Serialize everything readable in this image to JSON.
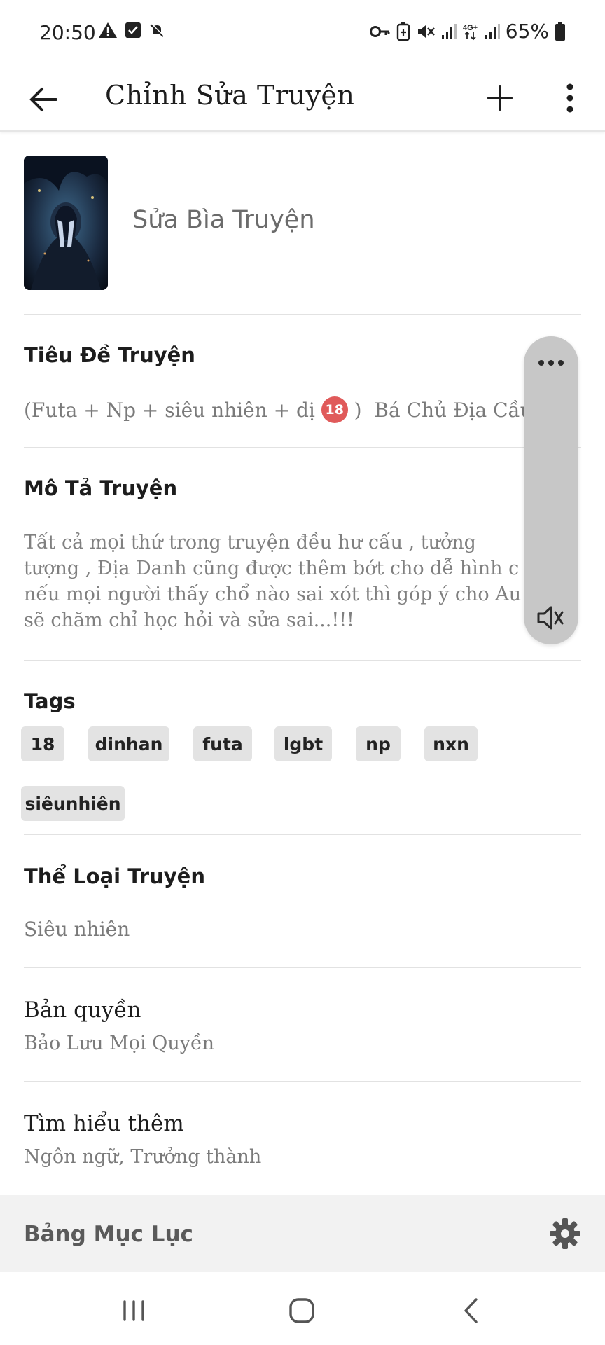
{
  "status_bar": {
    "time": "20:50",
    "battery_percent": "65%",
    "icons": [
      "warning-icon",
      "checkbox-icon",
      "mute-bell-icon",
      "key-icon",
      "battery-saver-icon",
      "vibrate-mute-icon",
      "signal-icon",
      "4g-icon",
      "signal-icon-2",
      "battery-icon"
    ]
  },
  "app_bar": {
    "title": "Chỉnh Sửa Truyện",
    "icons": [
      "back-arrow-icon",
      "plus-icon",
      "more-vert-icon"
    ]
  },
  "cover": {
    "label": "Sửa Bìa Truyện"
  },
  "story_title": {
    "label": "Tiêu Đề Truyện",
    "value_before_badge": "(Futa + Np + siêu nhiên + dị ",
    "badge": "18",
    "value_after_badge": " )  Bá Chủ Địa Cầu ."
  },
  "description": {
    "label": "Mô Tả Truyện",
    "lines": [
      "Tất cả mọi thứ trong truyện đều hư cấu , tưởng",
      "tượng  , Địa Danh cũng được thêm bớt cho dễ hình c",
      "nếu mọi người thấy chổ nào sai xót thì góp ý cho Au",
      "sẽ chăm chỉ học hỏi và sửa sai...!!!"
    ]
  },
  "tags": {
    "label": "Tags",
    "items": [
      "18",
      "dinhan",
      "futa",
      "lgbt",
      "np",
      "nxn",
      "siêunhiên"
    ]
  },
  "genre": {
    "label": "Thể Loại Truyện",
    "value": "Siêu nhiên"
  },
  "copyright": {
    "label": "Bản quyền",
    "value": "Bảo Lưu Mọi Quyền"
  },
  "learn_more": {
    "label": "Tìm hiểu thêm",
    "value": "Ngôn ngữ, Trưởng thành"
  },
  "toc": {
    "label": "Bảng Mục Lục"
  },
  "colors": {
    "tag_bg": "#e3e3e3",
    "divider": "#e2e2e2",
    "float_panel": "#c7c7c7",
    "badge_red": "#e05a5a"
  }
}
